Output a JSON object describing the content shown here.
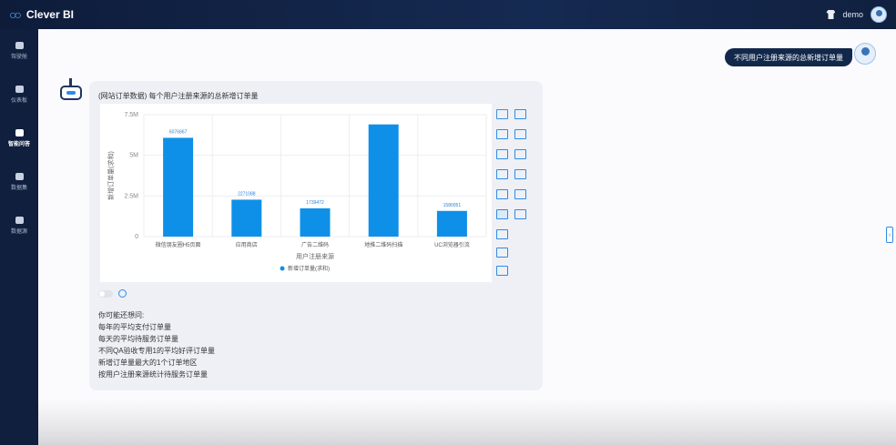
{
  "app": {
    "name": "Clever BI"
  },
  "user": {
    "name": "demo"
  },
  "sidebar": {
    "items": [
      {
        "label": "驾驶舱",
        "icon": "dashboard-gauge-icon",
        "active": false
      },
      {
        "label": "仪表板",
        "icon": "dashboard-icon",
        "active": false
      },
      {
        "label": "智能问答",
        "icon": "robot-icon",
        "active": true
      },
      {
        "label": "数据集",
        "icon": "dataset-icon",
        "active": false
      },
      {
        "label": "数据源",
        "icon": "datasource-icon",
        "active": false
      }
    ]
  },
  "conversation": {
    "question": "不同用户注册来源的总新增订单量",
    "answer_title": "(网站订单数据) 每个用户注册来源的总新增订单量",
    "suggest_header": "你可能还想问:",
    "suggestions": [
      "每年的平均支付订单量",
      "每天的平均待服务订单量",
      "不同QA验收专用1的平均好评订单量",
      "新增订单量最大的1个订单地区",
      "按用户注册来源统计待服务订单量"
    ]
  },
  "chart_data": {
    "type": "bar",
    "categories": [
      "微信朋友圈H5页面",
      "应用商店",
      "广告二维码",
      "地推二维码扫描",
      "UC浏览器引流"
    ],
    "series": [
      {
        "name": "新增订单量(求和)",
        "values": [
          6076867,
          2271088,
          1739472,
          6900000,
          1580051
        ]
      }
    ],
    "data_labels": [
      "6076867",
      "2271088",
      "1739472",
      "",
      "1580051"
    ],
    "xlabel": "用户注册来源",
    "ylabel": "新增订单量(求和)",
    "yticks": [
      "0",
      "2.5M",
      "5M",
      "7.5M"
    ],
    "ylim": [
      0,
      7500000
    ],
    "legend": "bottom",
    "color": "#0e90e8"
  },
  "chart_types": [
    "table-chart-icon",
    "treemap-icon",
    "pivot-table-icon",
    "tree-table-icon",
    "line-chart-icon",
    "funnel-chart-icon",
    "zigzag-line-icon",
    "map-icon",
    "stacked-bar-icon",
    "scatter-map-icon",
    "bar-chart-icon",
    "word-cloud-icon",
    "pie-chart-icon",
    "column-chart-icon",
    "area-chart-icon"
  ]
}
